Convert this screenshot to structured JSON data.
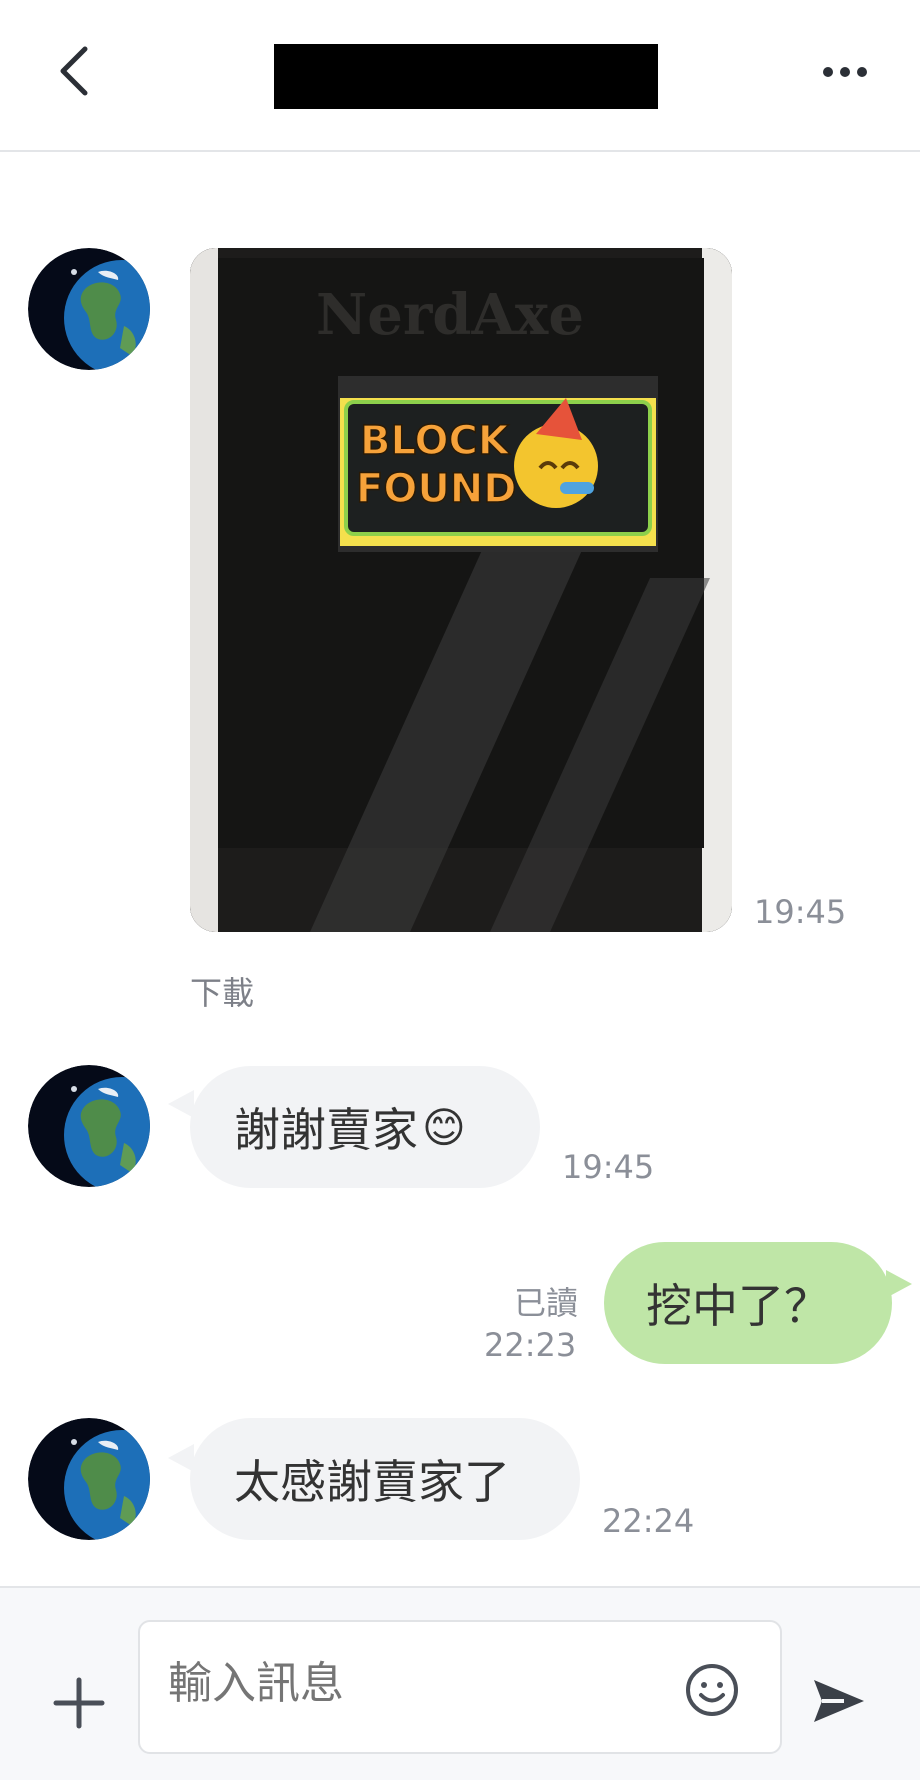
{
  "header": {
    "back_icon": "chevron-left-icon",
    "title_redacted": true,
    "more_icon": "more-dots-icon"
  },
  "messages": [
    {
      "type": "image",
      "direction": "incoming",
      "time": "19:45",
      "download_label": "下載",
      "image_text": {
        "brand": "NerdAxe",
        "headline_1": "BLOCK",
        "headline_2": "FOUND"
      }
    },
    {
      "type": "text",
      "direction": "incoming",
      "text": "謝謝賣家",
      "emoji": "😊",
      "time": "19:45"
    },
    {
      "type": "text",
      "direction": "outgoing",
      "text": "挖中了？",
      "read_label": "已讀",
      "time": "22:23"
    },
    {
      "type": "text",
      "direction": "incoming",
      "text": "太感謝賣家了",
      "time": "22:24"
    }
  ],
  "composer": {
    "plus_icon": "plus-icon",
    "placeholder": "輸入訊息",
    "emoji_icon": "smiley-icon",
    "send_icon": "send-icon"
  },
  "colors": {
    "incoming_bubble": "#f2f3f5",
    "outgoing_bubble": "#bfe6a7",
    "timestamp": "#8b8f98"
  }
}
